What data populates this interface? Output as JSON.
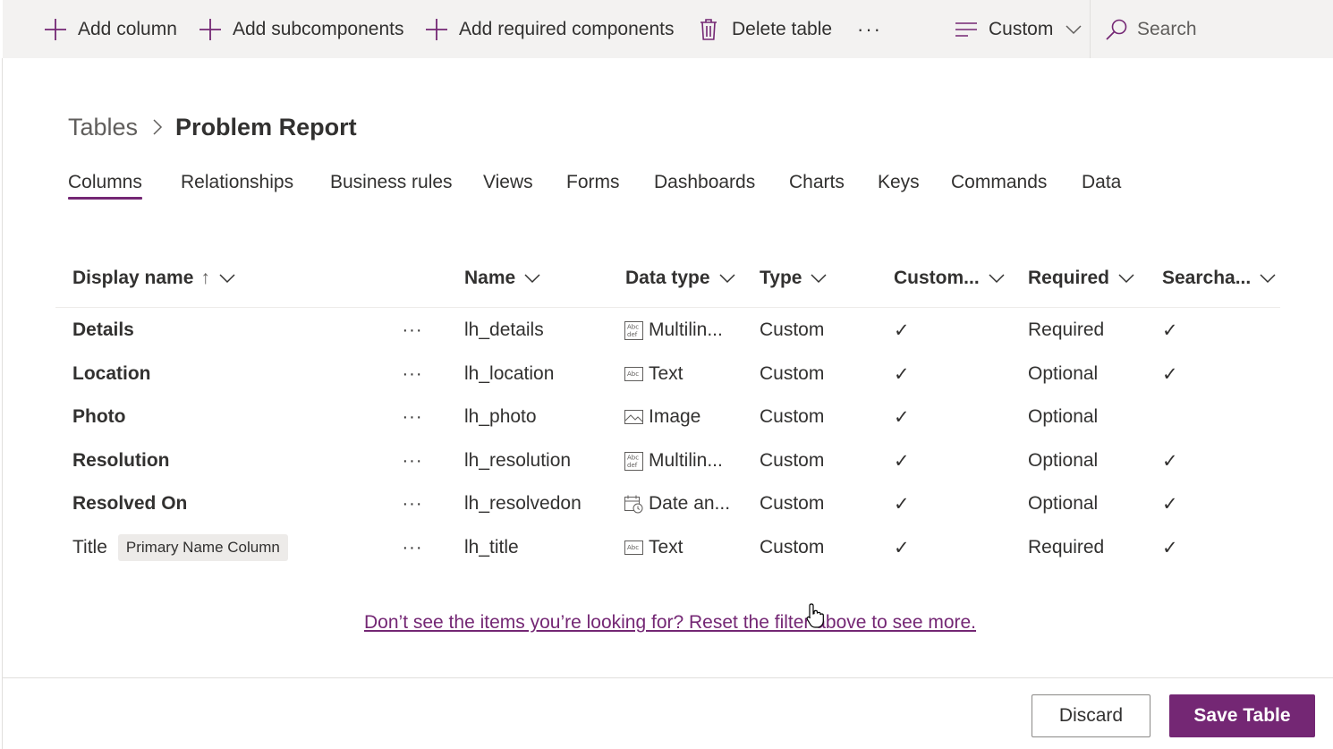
{
  "command_bar": {
    "add_column": "Add column",
    "add_subcomponents": "Add subcomponents",
    "add_required_components": "Add required components",
    "delete_table": "Delete table",
    "more": "···",
    "view_selector": "Custom",
    "search_placeholder": "Search"
  },
  "breadcrumb": {
    "parent": "Tables",
    "current": "Problem Report"
  },
  "tabs": [
    {
      "label": "Columns",
      "active": true
    },
    {
      "label": "Relationships"
    },
    {
      "label": "Business rules"
    },
    {
      "label": "Views"
    },
    {
      "label": "Forms"
    },
    {
      "label": "Dashboards"
    },
    {
      "label": "Charts"
    },
    {
      "label": "Keys"
    },
    {
      "label": "Commands"
    },
    {
      "label": "Data"
    }
  ],
  "table": {
    "headers": {
      "display_name": "Display name",
      "display_name_sort": "↑",
      "name": "Name",
      "data_type": "Data type",
      "type": "Type",
      "customizable": "Custom...",
      "required": "Required",
      "searchable": "Searcha..."
    },
    "row_more": "···",
    "check": "✓",
    "rows": [
      {
        "display_name": "Details",
        "name": "lh_details",
        "data_type": "Multilin...",
        "data_type_icon": "multiline-text-icon",
        "type": "Custom",
        "customizable": "✓",
        "required": "Required",
        "searchable": "✓"
      },
      {
        "display_name": "Location",
        "name": "lh_location",
        "data_type": "Text",
        "data_type_icon": "text-icon",
        "type": "Custom",
        "customizable": "✓",
        "required": "Optional",
        "searchable": "✓"
      },
      {
        "display_name": "Photo",
        "name": "lh_photo",
        "data_type": "Image",
        "data_type_icon": "image-icon",
        "type": "Custom",
        "customizable": "✓",
        "required": "Optional",
        "searchable": ""
      },
      {
        "display_name": "Resolution",
        "name": "lh_resolution",
        "data_type": "Multilin...",
        "data_type_icon": "multiline-text-icon",
        "type": "Custom",
        "customizable": "✓",
        "required": "Optional",
        "searchable": "✓"
      },
      {
        "display_name": "Resolved On",
        "name": "lh_resolvedon",
        "data_type": "Date an...",
        "data_type_icon": "date-time-icon",
        "type": "Custom",
        "customizable": "✓",
        "required": "Optional",
        "searchable": "✓"
      },
      {
        "display_name": "Title",
        "badge": "Primary Name Column",
        "name": "lh_title",
        "data_type": "Text",
        "data_type_icon": "text-icon",
        "type": "Custom",
        "customizable": "✓",
        "required": "Required",
        "searchable": "✓"
      }
    ]
  },
  "reset_filter_link": "Don’t see the items you’re looking for? Reset the filter above to see more.",
  "footer": {
    "discard": "Discard",
    "save": "Save Table"
  },
  "colors": {
    "accent": "#742774",
    "command_bar_bg": "#f3f2f1",
    "text": "#323130"
  }
}
